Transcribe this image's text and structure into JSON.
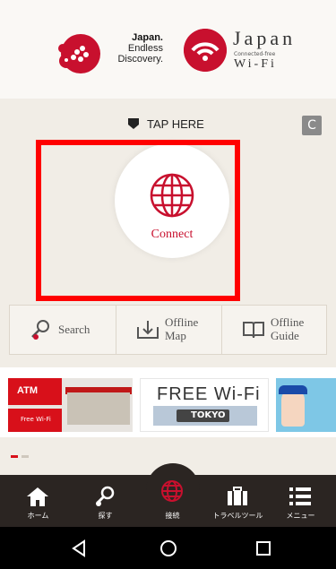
{
  "header": {
    "logo1": {
      "line1": "Japan.",
      "line2": "Endless",
      "line3": "Discovery."
    },
    "logo2": {
      "title": "Japan",
      "subtitle": "Connected-free",
      "wifi": "Wi-Fi"
    }
  },
  "tap_here": "TAP HERE",
  "connect": {
    "label": "Connect"
  },
  "features": [
    {
      "icon": "search-icon",
      "label": "Search"
    },
    {
      "icon": "offline-map-icon",
      "label": "Offline Map",
      "line1": "Offline",
      "line2": "Map"
    },
    {
      "icon": "offline-guide-icon",
      "label": "Offline Guide",
      "line1": "Offline",
      "line2": "Guide"
    }
  ],
  "banners": {
    "atm": {
      "atm_label": "ATM",
      "wifi_label": "Free Wi-Fi"
    },
    "free_wifi": {
      "title": "FREE Wi-Fi",
      "city": "TOKYO"
    }
  },
  "carousel": {
    "active_index": 0,
    "count": 2
  },
  "bottom_nav": [
    {
      "icon": "home-icon",
      "label": "ホーム"
    },
    {
      "icon": "search-icon",
      "label": "探す"
    },
    {
      "icon": "globe-icon",
      "label": "接続"
    },
    {
      "icon": "luggage-icon",
      "label": "トラベルツール"
    },
    {
      "icon": "menu-icon",
      "label": "メニュー"
    }
  ],
  "colors": {
    "accent": "#c8102e",
    "highlight": "#ff0000",
    "nav_bg": "#2b2522"
  }
}
